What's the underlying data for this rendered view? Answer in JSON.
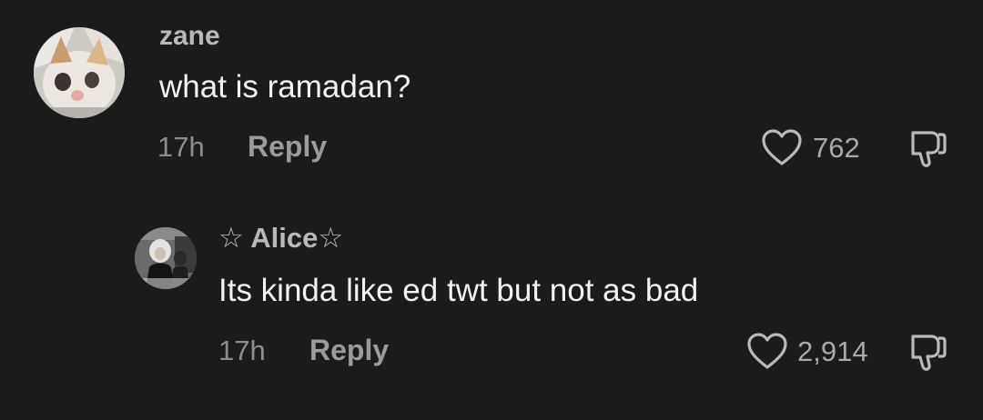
{
  "comments": [
    {
      "username": "zane",
      "text": "what is ramadan?",
      "time": "17h",
      "reply_label": "Reply",
      "likes": "762"
    },
    {
      "username": "☆ Alice☆",
      "text": "Its kinda like ed twt but not as bad",
      "time": "17h",
      "reply_label": "Reply",
      "likes": "2,914"
    }
  ],
  "colors": {
    "background": "#1b1b1b",
    "username": "#b9b9b9",
    "text": "#f2f2f2",
    "meta": "#8d8d8d"
  },
  "icons": {
    "like": "heart-outline-icon",
    "dislike": "thumbs-down-outline-icon"
  }
}
